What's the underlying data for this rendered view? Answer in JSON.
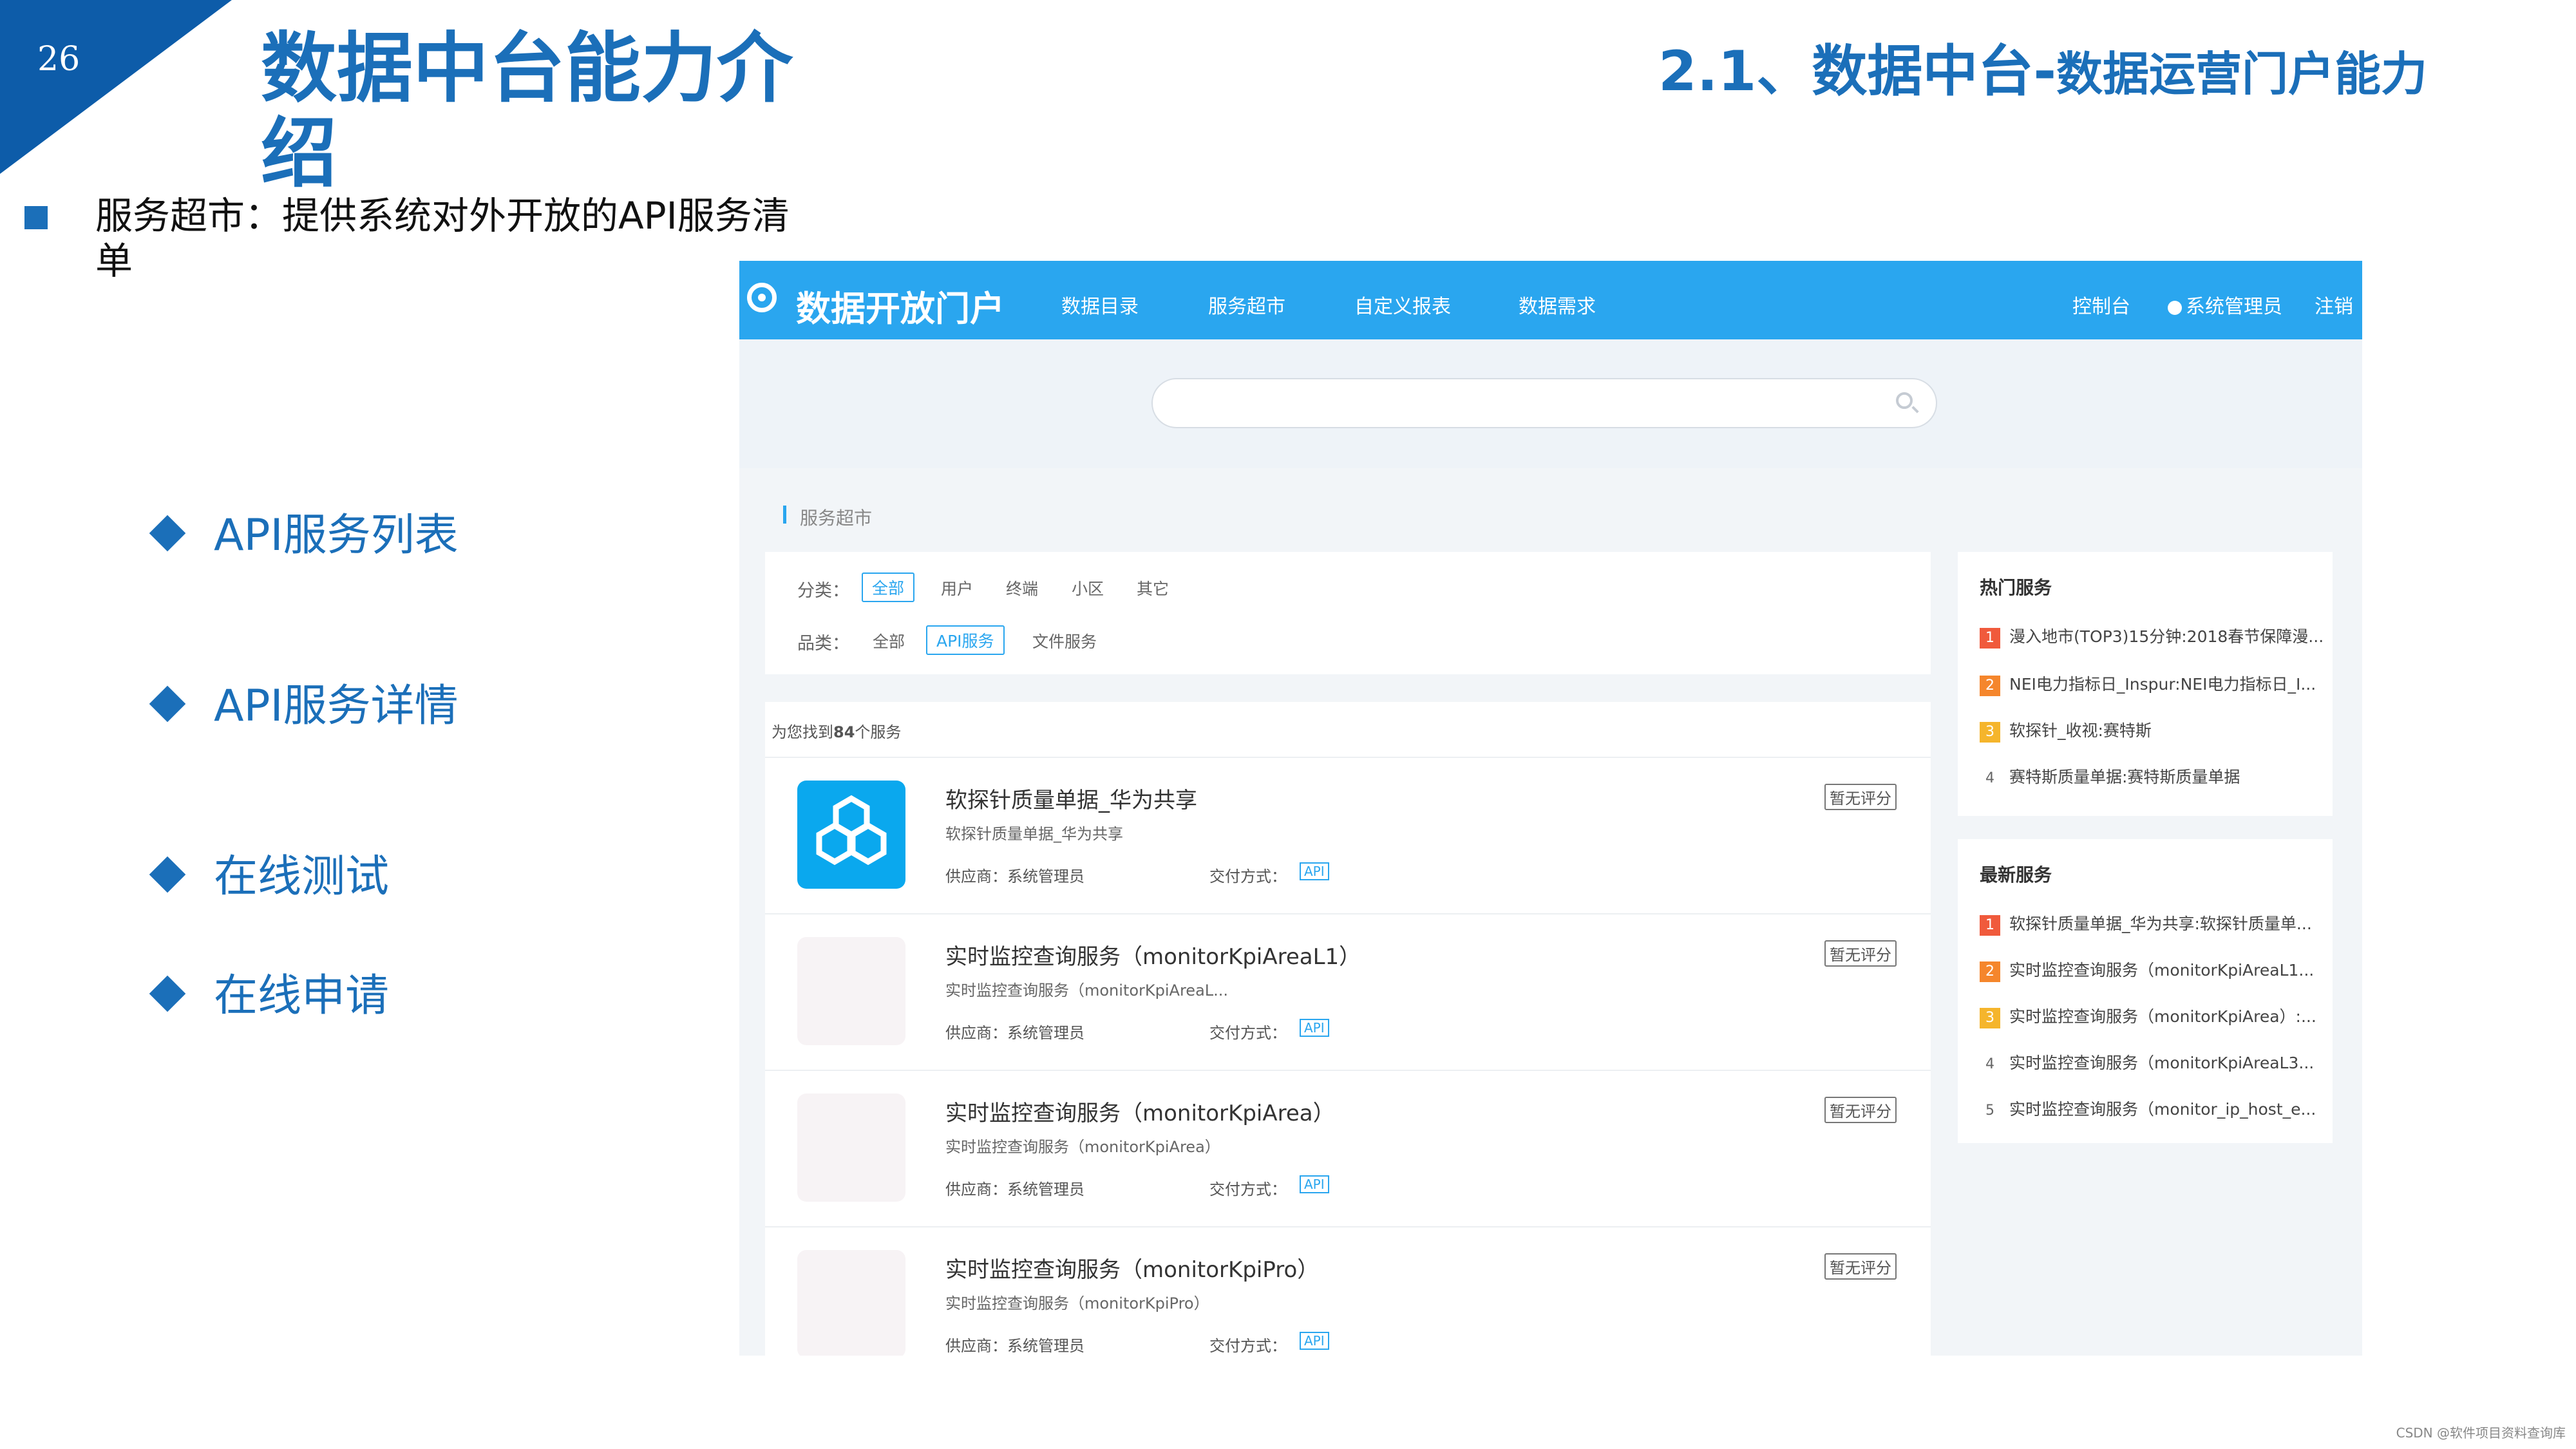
{
  "slide": {
    "page_number": "26",
    "title": "数据中台能力介绍",
    "section_title_main": "2.1、数据中台-",
    "section_title_sub": "数据运营门户能力",
    "intro": "服务超市：提供系统对外开放的API服务清单",
    "features": [
      "API服务列表",
      "API服务详情",
      "在线测试",
      "在线申请"
    ],
    "watermark": "CSDN @软件项目资料查询库"
  },
  "portal": {
    "brand": "数据开放门户",
    "nav": [
      "数据目录",
      "服务超市",
      "自定义报表",
      "数据需求"
    ],
    "nav_right": [
      "控制台",
      "系统管理员",
      "注销"
    ],
    "search_placeholder": "",
    "breadcrumb": "服务超市",
    "filter": {
      "category_label": "分类：",
      "categories": [
        "全部",
        "用户",
        "终端",
        "小区",
        "其它"
      ],
      "category_selected": "全部",
      "type_label": "品类：",
      "types": [
        "全部",
        "API服务",
        "文件服务"
      ],
      "type_selected": "API服务"
    },
    "found_prefix": "为您找到",
    "found_count": "84",
    "found_suffix": "个服务",
    "cards": [
      {
        "name": "软探针质量单据_华为共享",
        "sub": "软探针质量单据_华为共享",
        "provider": "供应商：系统管理员",
        "pay": "交付方式：",
        "api": "API",
        "rating": "暂无评分"
      },
      {
        "name": "实时监控查询服务（monitorKpiAreaL1）",
        "sub": "实时监控查询服务（monitorKpiAreaL...",
        "provider": "供应商：系统管理员",
        "pay": "交付方式：",
        "api": "API",
        "rating": "暂无评分"
      },
      {
        "name": "实时监控查询服务（monitorKpiArea）",
        "sub": "实时监控查询服务（monitorKpiArea）",
        "provider": "供应商：系统管理员",
        "pay": "交付方式：",
        "api": "API",
        "rating": "暂无评分"
      },
      {
        "name": "实时监控查询服务（monitorKpiPro）",
        "sub": "实时监控查询服务（monitorKpiPro）",
        "provider": "供应商：系统管理员",
        "pay": "交付方式：",
        "api": "API",
        "rating": "暂无评分"
      }
    ],
    "hot": {
      "title": "热门服务",
      "items": [
        {
          "rank": "1",
          "text": "漫入地市(TOP3)15分钟:2018春节保障漫..."
        },
        {
          "rank": "2",
          "text": "NEI电力指标日_Inspur:NEI电力指标日_I..."
        },
        {
          "rank": "3",
          "text": "软探针_收视:赛特斯"
        },
        {
          "rank": "4",
          "text": "赛特斯质量单据:赛特斯质量单据"
        }
      ]
    },
    "latest": {
      "title": "最新服务",
      "items": [
        {
          "rank": "1",
          "text": "软探针质量单据_华为共享:软探针质量单..."
        },
        {
          "rank": "2",
          "text": "实时监控查询服务（monitorKpiAreaL1..."
        },
        {
          "rank": "3",
          "text": "实时监控查询服务（monitorKpiArea）:..."
        },
        {
          "rank": "4",
          "text": "实时监控查询服务（monitorKpiAreaL3..."
        },
        {
          "rank": "5",
          "text": "实时监控查询服务（monitor_ip_host_e..."
        }
      ]
    },
    "colors": {
      "accent": "#2aa6ef",
      "slide_blue": "#1b6fb9",
      "rank1": "#f05a3c",
      "rank2": "#f5862c",
      "rank3": "#f5b52c"
    }
  }
}
